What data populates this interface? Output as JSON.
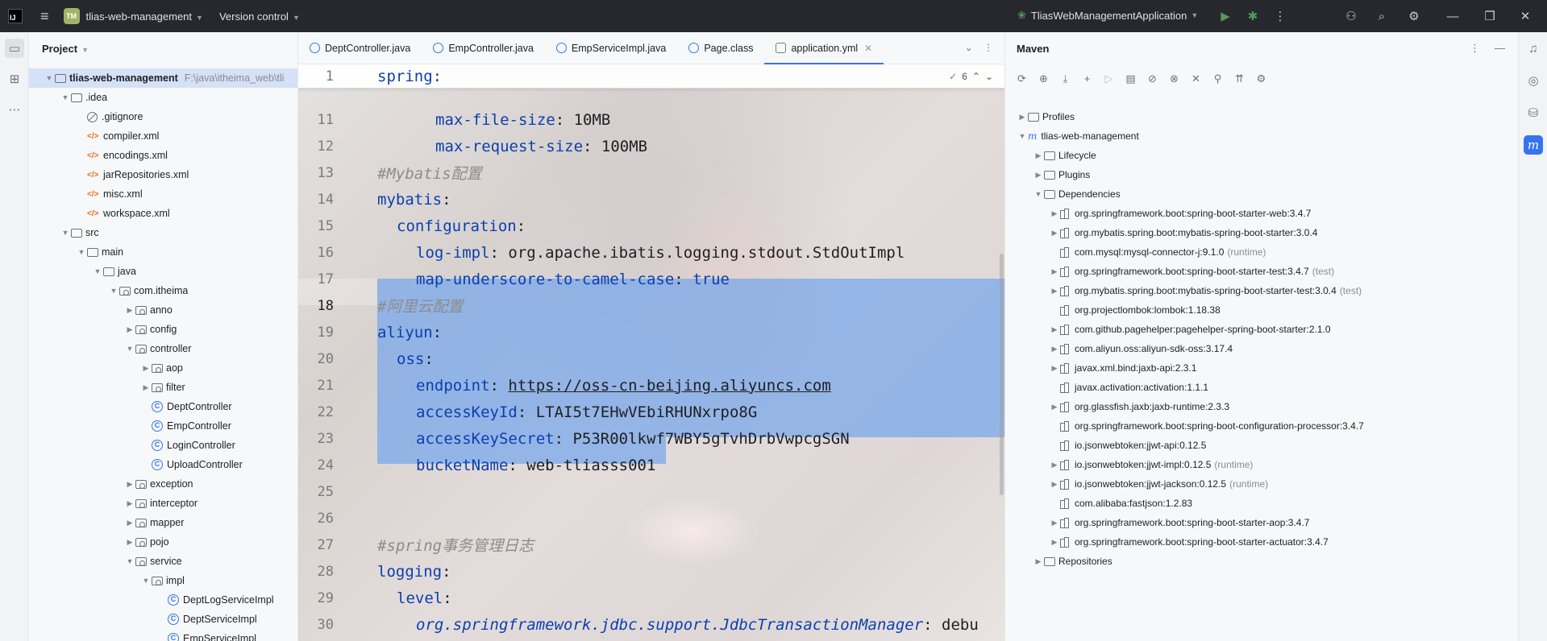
{
  "titlebar": {
    "logo": "IJ",
    "project_badge": "TM",
    "project_name": "tlias-web-management",
    "version_control": "Version control",
    "run_config": "TliasWebManagementApplication"
  },
  "project_panel": {
    "title": "Project",
    "root": "tlias-web-management",
    "root_path": "F:\\java\\itheima_web\\tli",
    "items": [
      {
        "label": ".idea",
        "kind": "folder"
      },
      {
        "label": ".gitignore",
        "kind": "ignore"
      },
      {
        "label": "compiler.xml",
        "kind": "xml"
      },
      {
        "label": "encodings.xml",
        "kind": "xml"
      },
      {
        "label": "jarRepositories.xml",
        "kind": "xml"
      },
      {
        "label": "misc.xml",
        "kind": "xml"
      },
      {
        "label": "workspace.xml",
        "kind": "xml"
      },
      {
        "label": "src",
        "kind": "folder"
      },
      {
        "label": "main",
        "kind": "folder"
      },
      {
        "label": "java",
        "kind": "folder"
      },
      {
        "label": "com.itheima",
        "kind": "pkg"
      },
      {
        "label": "anno",
        "kind": "pkg"
      },
      {
        "label": "config",
        "kind": "pkg"
      },
      {
        "label": "controller",
        "kind": "pkg"
      },
      {
        "label": "aop",
        "kind": "pkg"
      },
      {
        "label": "filter",
        "kind": "pkg"
      },
      {
        "label": "DeptController",
        "kind": "class"
      },
      {
        "label": "EmpController",
        "kind": "class"
      },
      {
        "label": "LoginController",
        "kind": "class"
      },
      {
        "label": "UploadController",
        "kind": "class"
      },
      {
        "label": "exception",
        "kind": "pkg"
      },
      {
        "label": "interceptor",
        "kind": "pkg"
      },
      {
        "label": "mapper",
        "kind": "pkg"
      },
      {
        "label": "pojo",
        "kind": "pkg"
      },
      {
        "label": "service",
        "kind": "pkg"
      },
      {
        "label": "impl",
        "kind": "pkg"
      },
      {
        "label": "DeptLogServiceImpl",
        "kind": "class"
      },
      {
        "label": "DeptServiceImpl",
        "kind": "class"
      },
      {
        "label": "EmpServiceImpl",
        "kind": "class"
      }
    ]
  },
  "editor": {
    "tabs": [
      {
        "label": "DeptController.java",
        "active": false
      },
      {
        "label": "EmpController.java",
        "active": false
      },
      {
        "label": "EmpServiceImpl.java",
        "active": false
      },
      {
        "label": "Page.class",
        "active": false
      },
      {
        "label": "application.yml",
        "active": true
      }
    ],
    "inspection_count": "6",
    "sticky_line": {
      "num": "1",
      "text": "spring:"
    },
    "lines": [
      {
        "num": "11",
        "key": "max-file-size",
        "value": "10MB",
        "indent": 6
      },
      {
        "num": "12",
        "key": "max-request-size",
        "value": "100MB",
        "indent": 6
      },
      {
        "num": "13",
        "comment": "#Mybatis配置",
        "indent": 0
      },
      {
        "num": "14",
        "key": "mybatis",
        "value": "",
        "indent": 0
      },
      {
        "num": "15",
        "key": "configuration",
        "value": "",
        "indent": 2
      },
      {
        "num": "16",
        "key": "log-impl",
        "value": "org.apache.ibatis.logging.stdout.StdOutImpl",
        "indent": 4
      },
      {
        "num": "17",
        "key": "map-underscore-to-camel-case",
        "value": "true",
        "indent": 4,
        "value_kw": true
      },
      {
        "num": "18",
        "comment": "#阿里云配置",
        "indent": 0
      },
      {
        "num": "19",
        "key": "aliyun",
        "value": "",
        "indent": 0
      },
      {
        "num": "20",
        "key": "oss",
        "value": "",
        "indent": 2
      },
      {
        "num": "21",
        "key": "endpoint",
        "value": "https://oss-cn-beijing.aliyuncs.com",
        "indent": 4,
        "link": true
      },
      {
        "num": "22",
        "key": "accessKeyId",
        "value": "LTAI5t7EHwVEbiRHUNxrpo8G",
        "indent": 4
      },
      {
        "num": "23",
        "key": "accessKeySecret",
        "value": "P53R00lkwf7WBY5gTvhDrbVwpcgSGN",
        "indent": 4
      },
      {
        "num": "24",
        "key": "bucketName",
        "value": "web-tliasss001",
        "indent": 4
      },
      {
        "num": "25",
        "blank": true
      },
      {
        "num": "26",
        "blank": true
      },
      {
        "num": "27",
        "comment": "#spring事务管理日志",
        "indent": 0
      },
      {
        "num": "28",
        "key": "logging",
        "value": "",
        "indent": 0
      },
      {
        "num": "29",
        "key": "level",
        "value": "",
        "indent": 2
      },
      {
        "num": "30",
        "key": "org.springframework.jdbc.support.JdbcTransactionManager",
        "value": "debu",
        "indent": 4,
        "italic_key": true
      },
      {
        "num": "31",
        "blank": true
      }
    ]
  },
  "maven_panel": {
    "title": "Maven",
    "profiles": "Profiles",
    "project": "tlias-web-management",
    "lifecycle": "Lifecycle",
    "plugins": "Plugins",
    "dependencies": "Dependencies",
    "repositories": "Repositories",
    "deps": [
      {
        "name": "org.springframework.boot:spring-boot-starter-web:3.4.7",
        "scope": "",
        "expand": true
      },
      {
        "name": "org.mybatis.spring.boot:mybatis-spring-boot-starter:3.0.4",
        "scope": "",
        "expand": true
      },
      {
        "name": "com.mysql:mysql-connector-j:9.1.0",
        "scope": "(runtime)",
        "expand": false
      },
      {
        "name": "org.springframework.boot:spring-boot-starter-test:3.4.7",
        "scope": "(test)",
        "expand": true
      },
      {
        "name": "org.mybatis.spring.boot:mybatis-spring-boot-starter-test:3.0.4",
        "scope": "(test)",
        "expand": true
      },
      {
        "name": "org.projectlombok:lombok:1.18.38",
        "scope": "",
        "expand": false
      },
      {
        "name": "com.github.pagehelper:pagehelper-spring-boot-starter:2.1.0",
        "scope": "",
        "expand": true
      },
      {
        "name": "com.aliyun.oss:aliyun-sdk-oss:3.17.4",
        "scope": "",
        "expand": true
      },
      {
        "name": "javax.xml.bind:jaxb-api:2.3.1",
        "scope": "",
        "expand": true
      },
      {
        "name": "javax.activation:activation:1.1.1",
        "scope": "",
        "expand": false
      },
      {
        "name": "org.glassfish.jaxb:jaxb-runtime:2.3.3",
        "scope": "",
        "expand": true
      },
      {
        "name": "org.springframework.boot:spring-boot-configuration-processor:3.4.7",
        "scope": "",
        "expand": false
      },
      {
        "name": "io.jsonwebtoken:jjwt-api:0.12.5",
        "scope": "",
        "expand": false
      },
      {
        "name": "io.jsonwebtoken:jjwt-impl:0.12.5",
        "scope": "(runtime)",
        "expand": true
      },
      {
        "name": "io.jsonwebtoken:jjwt-jackson:0.12.5",
        "scope": "(runtime)",
        "expand": true
      },
      {
        "name": "com.alibaba:fastjson:1.2.83",
        "scope": "",
        "expand": false
      },
      {
        "name": "org.springframework.boot:spring-boot-starter-aop:3.4.7",
        "scope": "",
        "expand": true
      },
      {
        "name": "org.springframework.boot:spring-boot-starter-actuator:3.4.7",
        "scope": "",
        "expand": true
      }
    ]
  },
  "colors": {
    "accent": "#3574f0",
    "selection": "#76a6eb",
    "yaml_key": "#0b3fb0",
    "comment": "#8c8c8c"
  }
}
